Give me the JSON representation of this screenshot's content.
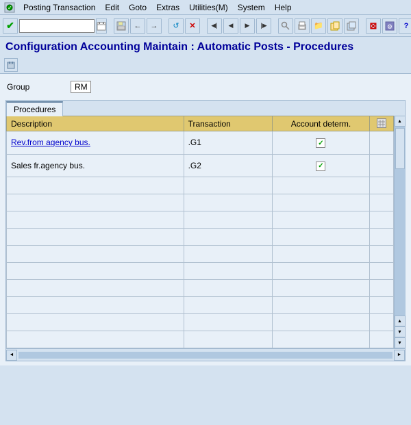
{
  "menubar": {
    "app_icon": "📋",
    "items": [
      {
        "label": "Posting Transaction",
        "underline_index": 0
      },
      {
        "label": "Edit",
        "underline_index": 0
      },
      {
        "label": "Goto",
        "underline_index": 0
      },
      {
        "label": "Extras",
        "underline_index": 0
      },
      {
        "label": "Utilities(M)",
        "underline_index": 0
      },
      {
        "label": "System",
        "underline_index": 0
      },
      {
        "label": "Help",
        "underline_index": 0
      }
    ]
  },
  "toolbar": {
    "command_input": "",
    "command_placeholder": ""
  },
  "title": "Configuration Accounting Maintain : Automatic Posts - Procedures",
  "group": {
    "label": "Group",
    "value": "RM"
  },
  "tab": {
    "label": "Procedures"
  },
  "table": {
    "columns": [
      {
        "key": "description",
        "label": "Description"
      },
      {
        "key": "transaction",
        "label": "Transaction"
      },
      {
        "key": "account_determ",
        "label": "Account determ."
      }
    ],
    "rows": [
      {
        "description": "Rev.from agency bus.",
        "transaction": ".G1",
        "account_determ": true,
        "is_link": true
      },
      {
        "description": "Sales fr.agency bus.",
        "transaction": ".G2",
        "account_determ": true,
        "is_link": false
      }
    ]
  },
  "icons": {
    "checkmark": "✓",
    "arrow_up": "▲",
    "arrow_down": "▼",
    "arrow_left": "◄",
    "arrow_right": "►",
    "nav_first": "◀◀",
    "nav_prev": "◀",
    "nav_next": "▶",
    "nav_last": "▶▶",
    "save": "💾",
    "back": "←",
    "forward": "→",
    "stop": "✕",
    "refresh": "↺",
    "settings": "⚙",
    "help": "?",
    "green_check": "✔",
    "folder": "📁",
    "page": "📄",
    "scroll_up": "▲",
    "scroll_down": "▼",
    "scroll_left": "◄",
    "scroll_right": "►",
    "grid_icon": "▦"
  }
}
